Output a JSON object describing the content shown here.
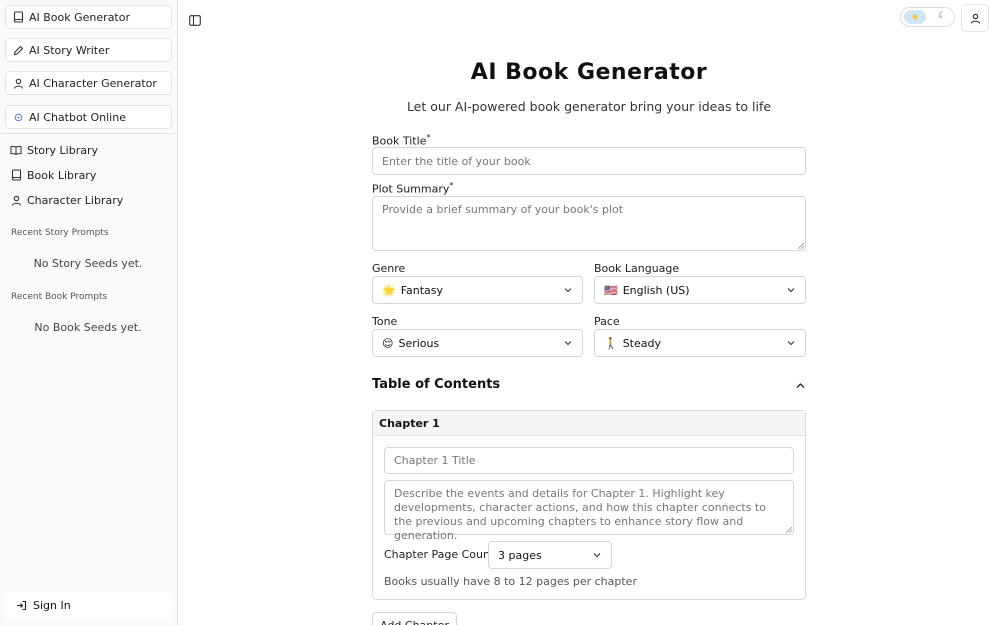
{
  "sidebar": {
    "top_buttons": [
      {
        "label": "AI Book Generator",
        "icon": "book-icon"
      },
      {
        "label": "AI Story Writer",
        "icon": "pencil-icon"
      },
      {
        "label": "AI Character Generator",
        "icon": "user-icon"
      },
      {
        "label": "AI Chatbot Online",
        "icon": "chatbot-icon"
      }
    ],
    "nav_items": [
      {
        "label": "Story Library",
        "icon": "open-book-icon"
      },
      {
        "label": "Book Library",
        "icon": "book-icon"
      },
      {
        "label": "Character Library",
        "icon": "user-icon"
      }
    ],
    "recent_story_label": "Recent Story Prompts",
    "recent_story_empty": "No Story Seeds yet.",
    "recent_book_label": "Recent Book Prompts",
    "recent_book_empty": "No Book Seeds yet.",
    "sign_in_label": "Sign In"
  },
  "header": {
    "title": "AI Book Generator",
    "subtitle": "Let our AI-powered book generator bring your ideas to life"
  },
  "form": {
    "book_title_label": "Book Title",
    "book_title_placeholder": "Enter the title of your book",
    "plot_summary_label": "Plot Summary",
    "plot_summary_placeholder": "Provide a brief summary of your book's plot",
    "required_mark": "*",
    "genre_label": "Genre",
    "genre_emoji": "🌟",
    "genre_value": "Fantasy",
    "language_label": "Book Language",
    "language_emoji": "🇺🇸",
    "language_value": "English (US)",
    "tone_label": "Tone",
    "tone_emoji": "😌",
    "tone_value": "Serious",
    "pace_label": "Pace",
    "pace_emoji": "🚶",
    "pace_value": "Steady"
  },
  "toc": {
    "title": "Table of Contents",
    "chapter_heading": "Chapter 1",
    "chapter_title_placeholder": "Chapter 1 Title",
    "chapter_desc_placeholder": "Describe the events and details for Chapter 1. Highlight key developments, character actions, and how this chapter connects to the previous and upcoming chapters to enhance story flow and generation.",
    "page_count_label": "Chapter Page Count",
    "page_count_value": "3 pages",
    "hint": "Books usually have 8 to 12 pages per chapter",
    "add_chapter_label": "Add Chapter"
  },
  "colors": {
    "accent_toggle": "#cfe6f7",
    "border": "#d6d6d6",
    "sidebar_bg": "#fafafa"
  }
}
